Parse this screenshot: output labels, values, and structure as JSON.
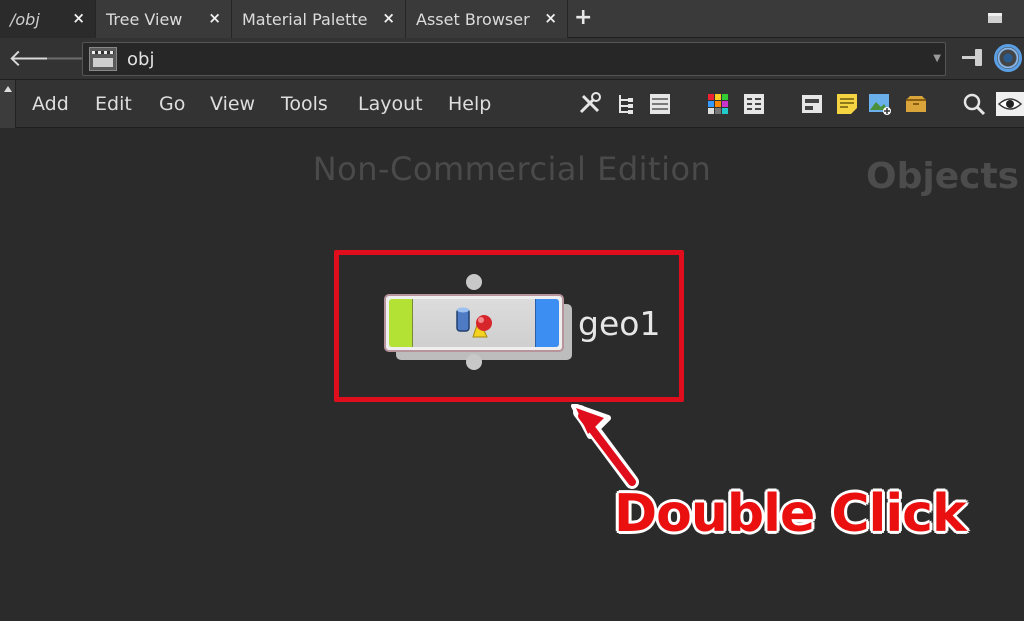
{
  "tabs": [
    {
      "label": "/obj",
      "active": true
    },
    {
      "label": "Tree View",
      "active": false
    },
    {
      "label": "Material Palette",
      "active": false
    },
    {
      "label": "Asset Browser",
      "active": false
    }
  ],
  "tab_close_glyph": "×",
  "tab_add_glyph": "+",
  "path": {
    "value": "obj"
  },
  "menu": [
    "Add",
    "Edit",
    "Go",
    "View",
    "Tools",
    "Layout",
    "Help"
  ],
  "toolbar_icons": [
    "tools-icon",
    "tree-icon",
    "list-icon",
    "color-grid-icon",
    "table-icon",
    "network-box-icon",
    "sticky-note-icon",
    "image-icon",
    "asset-icon",
    "search-icon",
    "eye-icon"
  ],
  "watermark": "Non-Commercial Edition",
  "context_label": "Objects",
  "node": {
    "name": "geo1",
    "icon": "geometry-icon",
    "left_color": "#b4e234",
    "right_color": "#3d8ef2"
  },
  "annotation": {
    "text": "Double Click",
    "color": "#e00d1c"
  }
}
